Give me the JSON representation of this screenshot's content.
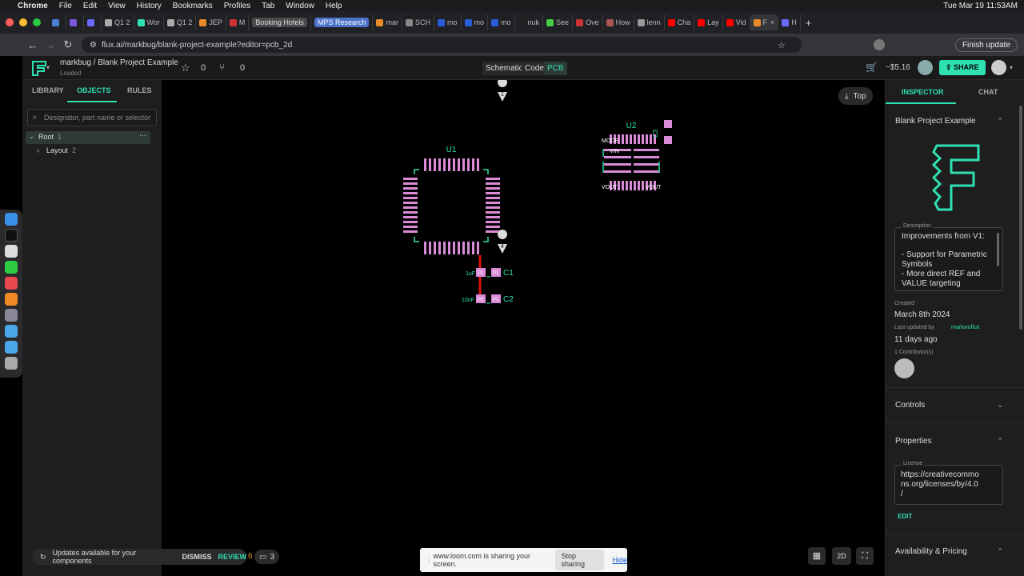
{
  "menubar": {
    "app": "Chrome",
    "items": [
      "File",
      "Edit",
      "View",
      "History",
      "Bookmarks",
      "Profiles",
      "Tab",
      "Window",
      "Help"
    ],
    "clock": "Tue Mar 19  11:53AM"
  },
  "tabs": [
    "Q1 2",
    "Wor",
    "Q1 2",
    "JEP",
    "M",
    "Booking Hotels",
    "MPS Research",
    "mar",
    "SCH",
    "mo",
    "mo",
    "mo",
    "nuk",
    "See",
    "Ove",
    "How",
    "lenn",
    "Cha",
    "Lay",
    "Vid",
    "F",
    "H"
  ],
  "address": {
    "url": "flux.ai/markbug/blank-project-example?editor=pcb_2d",
    "finish_update": "Finish update"
  },
  "header": {
    "breadcrumb": "markbug / Blank Project Example",
    "status": "Loaded",
    "stars": "0",
    "forks": "0",
    "modes": [
      "Schematic",
      "Code",
      "PCB"
    ],
    "active_mode": "PCB",
    "price": "~$5.16",
    "share": "SHARE"
  },
  "left": {
    "tabs": [
      "LIBRARY",
      "OBJECTS",
      "RULES"
    ],
    "search_placeholder": "Designator, part name or selector",
    "tree": {
      "root": "Root",
      "root_count": "1",
      "layout": "Layout",
      "layout_count": "2"
    }
  },
  "canvas": {
    "view_side": "Top",
    "pin1": "1",
    "pin4": "4",
    "u1": "U1",
    "u2": "U2",
    "c1": "C1",
    "c2": "C2",
    "c1_value": "1uF",
    "c2_value": "10nF",
    "p1": "P1",
    "p2": "P2",
    "u2_labels": {
      "mode": "MODE",
      "vin": "VIN",
      "vout1": "VOUT",
      "vout2": "VOUT",
      "c3": "C3"
    },
    "toolbar": {
      "mode_2d": "2D"
    },
    "counts": {
      "a": "6",
      "b": "3"
    }
  },
  "update_banner": {
    "text": "Updates available for your components",
    "dismiss": "DISMISS",
    "review": "REVIEW"
  },
  "loom": {
    "text": "www.loom.com is sharing your screen.",
    "stop": "Stop sharing",
    "hide": "Hide"
  },
  "right": {
    "tabs": [
      "INSPECTOR",
      "CHAT"
    ],
    "project_title": "Blank Project Example",
    "description_label": "Description",
    "description": [
      "Improvements from V1:",
      "",
      "- Support for Parametric",
      "Symbols",
      "- More direct REF and",
      "VALUE targeting"
    ],
    "created_label": "Created",
    "created": "March 8th 2024",
    "updated_label": "Last updated by",
    "updated_by": "markwuflux",
    "updated_ago": "11 days ago",
    "contributors": "1 Contributor(s)",
    "controls": "Controls",
    "properties": "Properties",
    "license_label": "License",
    "license": [
      "https://creativecommo",
      "ns.org/licenses/by/4.0",
      "/"
    ],
    "edit": "EDIT",
    "availability": "Availability & Pricing"
  },
  "colors": {
    "accent": "#2fe0b0",
    "pad": "#d98bd8",
    "trace": "#e01010"
  }
}
